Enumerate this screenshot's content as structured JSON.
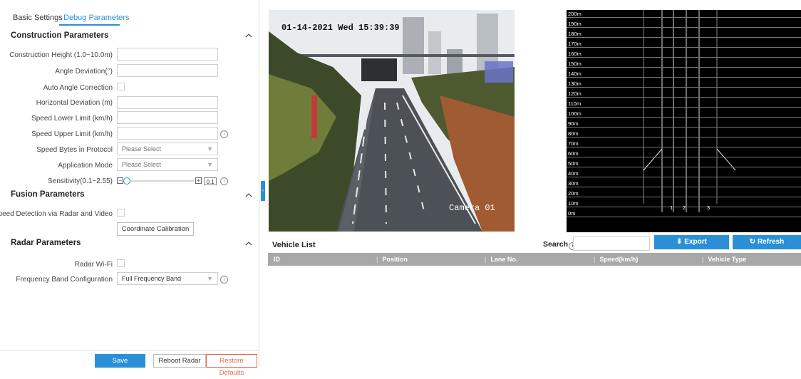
{
  "tabs": [
    {
      "label": "Basic Settings"
    },
    {
      "label": "Debug Parameters"
    }
  ],
  "construction": {
    "title": "Construction Parameters",
    "collapse": "^",
    "height_label": "Construction Height (1.0~10.0m)",
    "angle_label": "Angle Deviation(°)",
    "auto_angle_label": "Auto Angle Correction",
    "horizontal_label": "Horizontal Deviation (m)",
    "speed_lower_label": "Speed Lower Limit (km/h)",
    "speed_upper_label": "Speed Upper Limit (km/h)",
    "speed_bytes_label": "Speed Bytes in Protocol",
    "speed_bytes_value": "Please Select",
    "app_mode_label": "Application Mode",
    "app_mode_value": "Please Select",
    "sensitivity_label": "Sensitivity(0.1~2.55)",
    "sensitivity_value": "0.1",
    "sensitivity_level": 0
  },
  "fusion": {
    "title": "Fusion Parameters",
    "collapse": "^",
    "speed_detection_label": "Speed Detection via Radar and Video",
    "coord_button": "Coordinate Calibration"
  },
  "radar_params": {
    "title": "Radar Parameters",
    "collapse": "^",
    "wifi_label": "Radar Wi-Fi",
    "freq_label": "Frequency Band Configuration",
    "freq_value": "Full Frequency Band"
  },
  "footer": {
    "save": "Save",
    "reboot": "Reboot Radar",
    "restore": "Restore Defaults"
  },
  "camera": {
    "osd": "01-14-2021 Wed 15:39:39",
    "name": "Camera 01"
  },
  "radar_view": {
    "distance_labels": [
      "200m",
      "190m",
      "180m",
      "170m",
      "160m",
      "150m",
      "140m",
      "130m",
      "120m",
      "110m",
      "100m",
      "90m",
      "80m",
      "70m",
      "60m",
      "50m",
      "40m",
      "30m",
      "20m",
      "10m",
      "0m"
    ],
    "lanes": [
      "1",
      "2",
      "3"
    ]
  },
  "vehicle_list": {
    "title": "Vehicle List",
    "search_label": "Search",
    "export": "Export",
    "refresh": "Refresh",
    "columns": [
      "ID",
      "Position",
      "Lane No.",
      "Speed(km/h)",
      "Vehicle Type"
    ]
  },
  "icons": {
    "info": "info-icon",
    "export": "export-icon",
    "refresh": "refresh-icon",
    "dropdown": "chevron-down-icon"
  },
  "colors": {
    "accent": "#2b8fd8",
    "restore": "#e16b4d",
    "table_header": "#a8a8a8"
  }
}
